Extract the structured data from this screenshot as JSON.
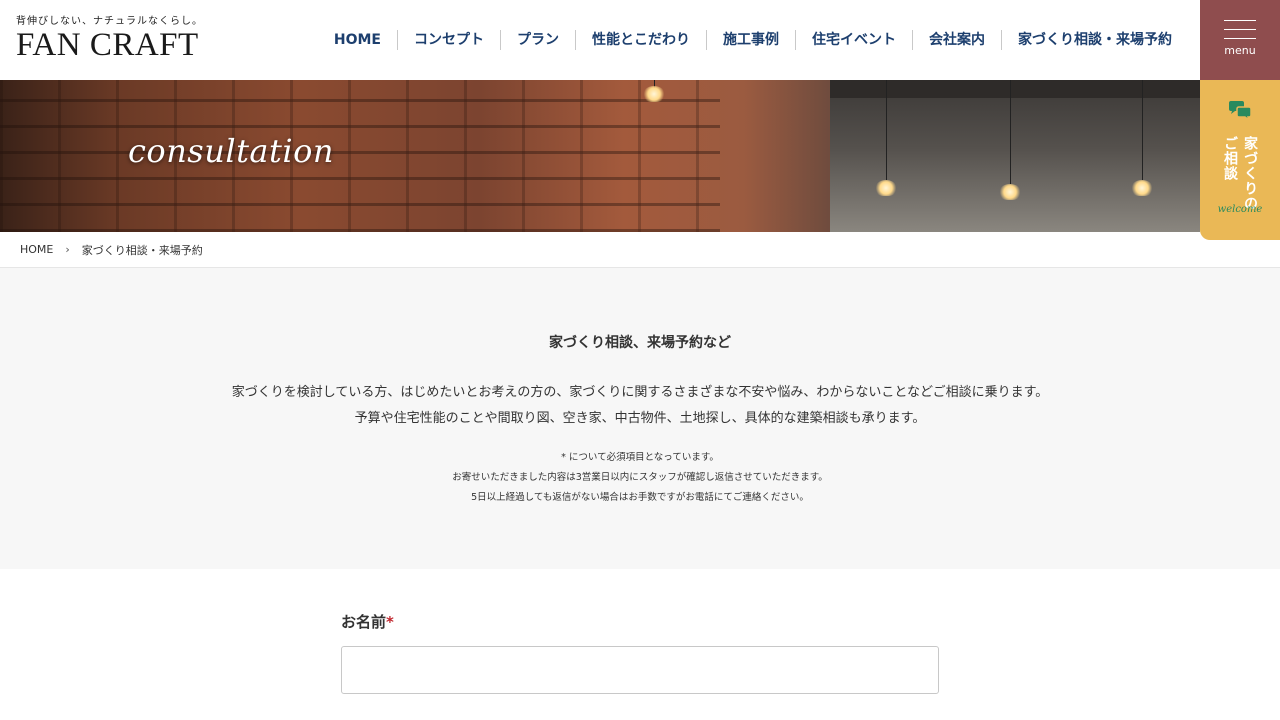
{
  "header": {
    "tagline": "背伸びしない、ナチュラルなくらし。",
    "brand": "FAN CRAFT",
    "nav": [
      "HOME",
      "コンセプト",
      "プラン",
      "性能とこだわり",
      "施工事例",
      "住宅イベント",
      "会社案内",
      "家づくり相談・来場予約"
    ],
    "menu_label": "menu"
  },
  "welcome_tab": {
    "icon": "chat-bubbles-icon",
    "vertical_lines": [
      "家づくりの",
      "ご相談"
    ],
    "script": "welcome"
  },
  "hero": {
    "title": "consultation"
  },
  "breadcrumb": {
    "home": "HOME",
    "separator": "›",
    "current": "家づくり相談・来場予約"
  },
  "intro": {
    "heading": "家づくり相談、来場予約など",
    "lines": [
      "家づくりを検討している方、はじめたいとお考えの方の、家づくりに関するさまざまな不安や悩み、わからないことなどご相談に乗ります。",
      "予算や住宅性能のことや間取り図、空き家、中古物件、土地探し、具体的な建築相談も承ります。"
    ],
    "notes": [
      "* について必須項目となっています。",
      "お寄せいただきました内容は3営業日以内にスタッフが確認し返信させていただきます。",
      "5日以上経過しても返信がない場合はお手数ですがお電話にてご連絡ください。"
    ]
  },
  "form": {
    "name_label": "お名前",
    "required_mark": "*",
    "name_value": ""
  },
  "colors": {
    "nav_text": "#1d3f6e",
    "menu_bg": "#8f4d4e",
    "welcome_bg": "#eab856",
    "welcome_accent": "#2a8a5e",
    "required": "#c0262d"
  }
}
